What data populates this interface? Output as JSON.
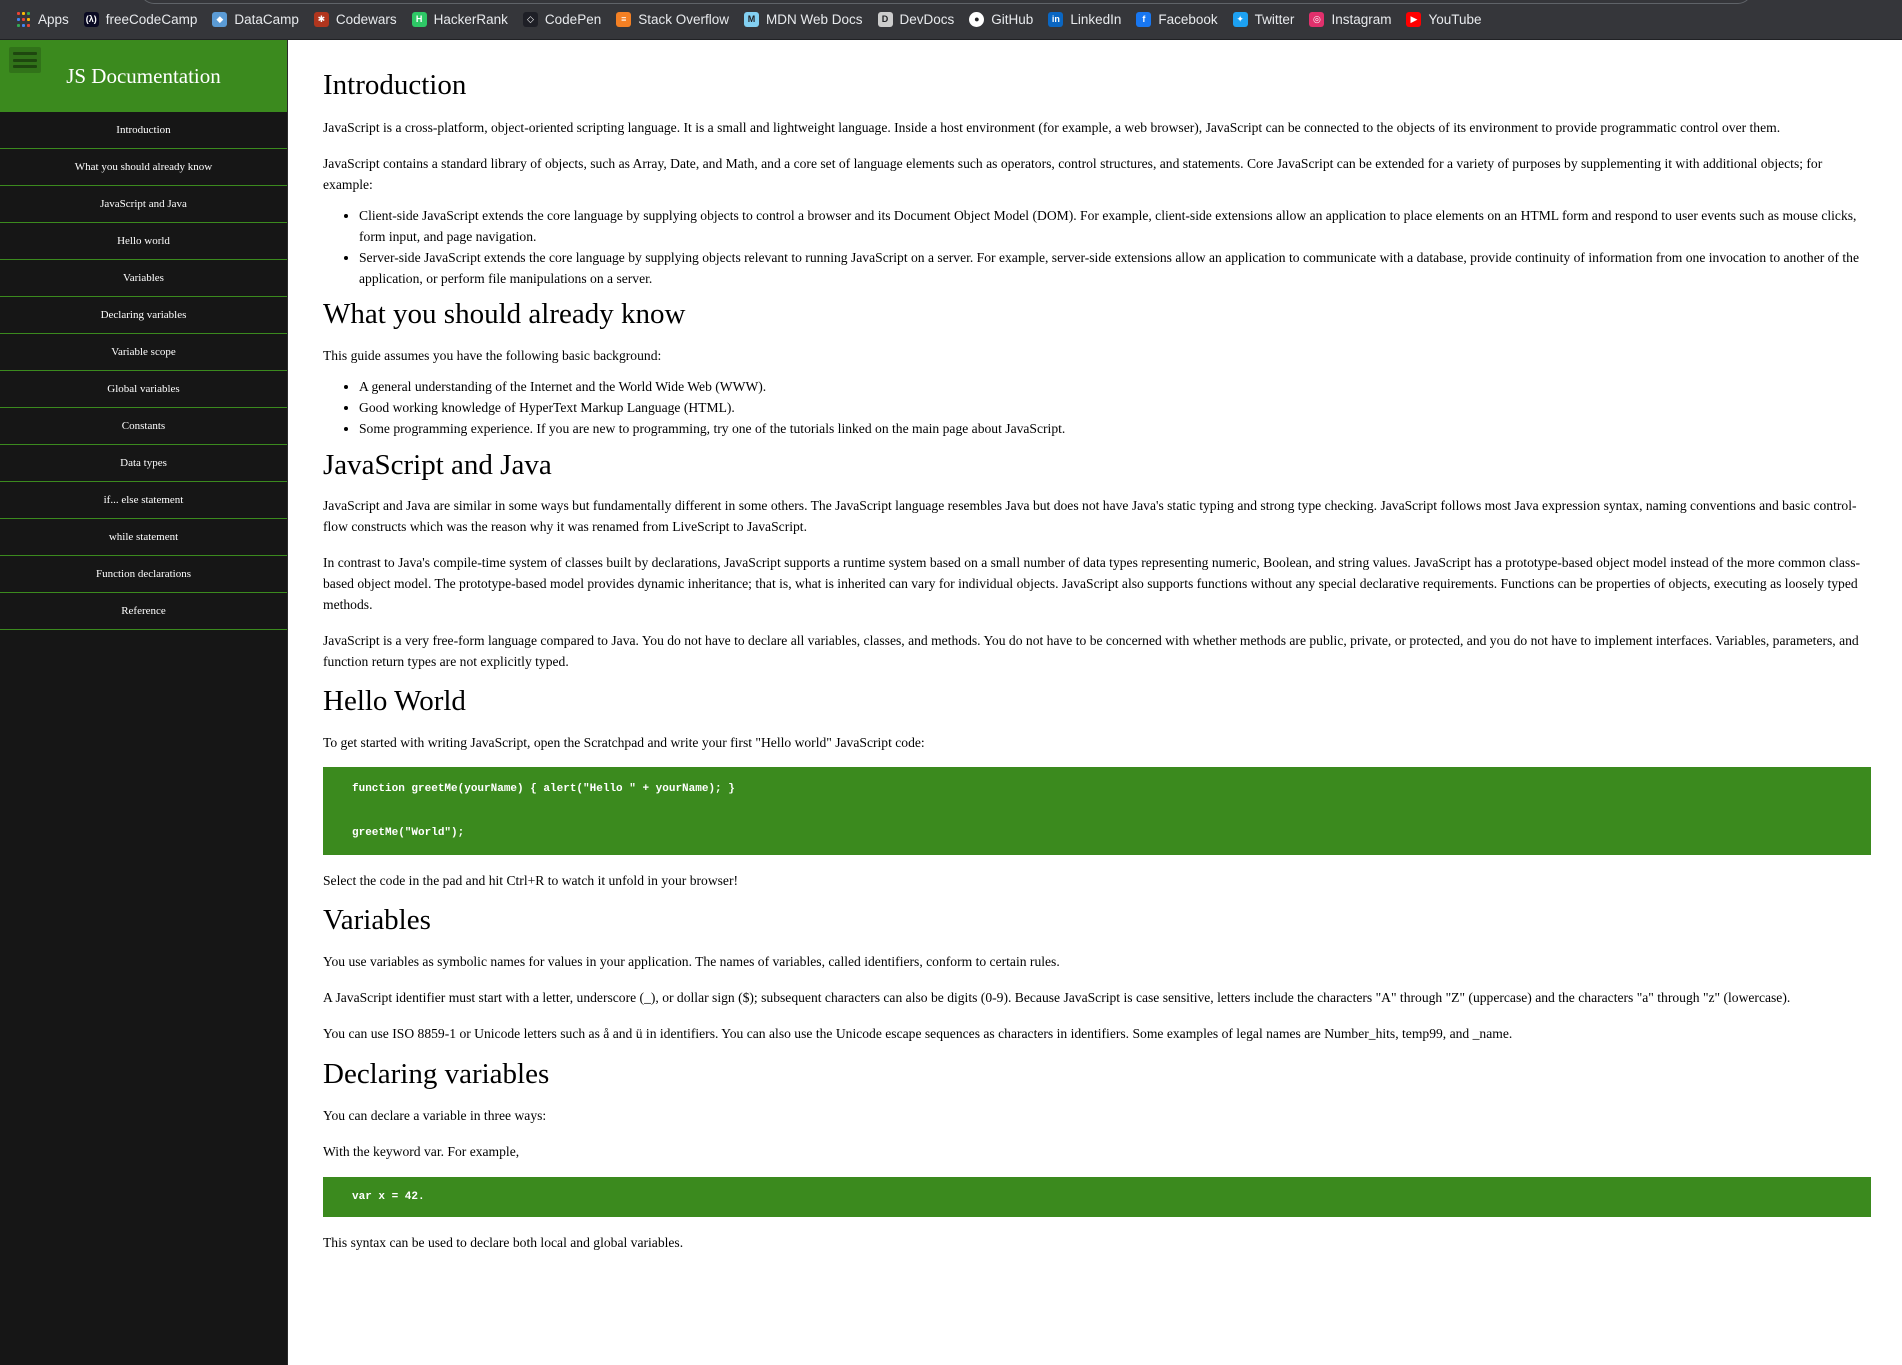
{
  "bookmarks": {
    "items": [
      {
        "label": "Apps",
        "icon": "apps-grid-icon"
      },
      {
        "label": "freeCodeCamp",
        "icon": "freecodecamp-icon",
        "color": "#0a0a23"
      },
      {
        "label": "DataCamp",
        "icon": "datacamp-icon",
        "color": "#5b9bd5"
      },
      {
        "label": "Codewars",
        "icon": "codewars-icon",
        "color": "#b1361e"
      },
      {
        "label": "HackerRank",
        "icon": "hackerrank-icon",
        "color": "#2ec866"
      },
      {
        "label": "CodePen",
        "icon": "codepen-icon",
        "color": "#1e1f26"
      },
      {
        "label": "Stack Overflow",
        "icon": "stackoverflow-icon",
        "color": "#f48024"
      },
      {
        "label": "MDN Web Docs",
        "icon": "mdn-icon",
        "color": "#83d0f2"
      },
      {
        "label": "DevDocs",
        "icon": "devdocs-icon",
        "color": "#cccccc"
      },
      {
        "label": "GitHub",
        "icon": "github-icon",
        "color": "#ffffff"
      },
      {
        "label": "LinkedIn",
        "icon": "linkedin-icon",
        "color": "#0a66c2"
      },
      {
        "label": "Facebook",
        "icon": "facebook-icon",
        "color": "#1877f2"
      },
      {
        "label": "Twitter",
        "icon": "twitter-icon",
        "color": "#1da1f2"
      },
      {
        "label": "Instagram",
        "icon": "instagram-icon",
        "color": "#e1306c"
      },
      {
        "label": "YouTube",
        "icon": "youtube-icon",
        "color": "#ff0000"
      }
    ]
  },
  "sidebar": {
    "title": "JS Documentation",
    "accent": "#3b8a1e",
    "background": "#161616",
    "items": [
      {
        "label": "Introduction"
      },
      {
        "label": "What you should already know"
      },
      {
        "label": "JavaScript and Java"
      },
      {
        "label": "Hello world"
      },
      {
        "label": "Variables"
      },
      {
        "label": "Declaring variables"
      },
      {
        "label": "Variable scope"
      },
      {
        "label": "Global variables"
      },
      {
        "label": "Constants"
      },
      {
        "label": "Data types"
      },
      {
        "label": "if... else statement"
      },
      {
        "label": "while statement"
      },
      {
        "label": "Function declarations"
      },
      {
        "label": "Reference"
      }
    ]
  },
  "main": {
    "intro": {
      "heading": "Introduction",
      "p1": "JavaScript is a cross-platform, object-oriented scripting language. It is a small and lightweight language. Inside a host environment (for example, a web browser), JavaScript can be connected to the objects of its environment to provide programmatic control over them.",
      "p2": "JavaScript contains a standard library of objects, such as Array, Date, and Math, and a core set of language elements such as operators, control structures, and statements. Core JavaScript can be extended for a variety of purposes by supplementing it with additional objects; for example:",
      "li1": "Client-side JavaScript extends the core language by supplying objects to control a browser and its Document Object Model (DOM). For example, client-side extensions allow an application to place elements on an HTML form and respond to user events such as mouse clicks, form input, and page navigation.",
      "li2": "Server-side JavaScript extends the core language by supplying objects relevant to running JavaScript on a server. For example, server-side extensions allow an application to communicate with a database, provide continuity of information from one invocation to another of the application, or perform file manipulations on a server."
    },
    "know": {
      "heading": "What you should already know",
      "p1": "This guide assumes you have the following basic background:",
      "li1": "A general understanding of the Internet and the World Wide Web (WWW).",
      "li2": "Good working knowledge of HyperText Markup Language (HTML).",
      "li3": "Some programming experience. If you are new to programming, try one of the tutorials linked on the main page about JavaScript."
    },
    "java": {
      "heading": "JavaScript and Java",
      "p1": "JavaScript and Java are similar in some ways but fundamentally different in some others. The JavaScript language resembles Java but does not have Java's static typing and strong type checking. JavaScript follows most Java expression syntax, naming conventions and basic control-flow constructs which was the reason why it was renamed from LiveScript to JavaScript.",
      "p2": "In contrast to Java's compile-time system of classes built by declarations, JavaScript supports a runtime system based on a small number of data types representing numeric, Boolean, and string values. JavaScript has a prototype-based object model instead of the more common class-based object model. The prototype-based model provides dynamic inheritance; that is, what is inherited can vary for individual objects. JavaScript also supports functions without any special declarative requirements. Functions can be properties of objects, executing as loosely typed methods.",
      "p3": "JavaScript is a very free-form language compared to Java. You do not have to declare all variables, classes, and methods. You do not have to be concerned with whether methods are public, private, or protected, and you do not have to implement interfaces. Variables, parameters, and function return types are not explicitly typed."
    },
    "hello": {
      "heading": "Hello World",
      "p1": "To get started with writing JavaScript, open the Scratchpad and write your first \"Hello world\" JavaScript code:",
      "code1": "function greetMe(yourName) { alert(\"Hello \" + yourName); }",
      "code2": "greetMe(\"World\");",
      "p2": "Select the code in the pad and hit Ctrl+R to watch it unfold in your browser!"
    },
    "variables": {
      "heading": "Variables",
      "p1": "You use variables as symbolic names for values in your application. The names of variables, called identifiers, conform to certain rules.",
      "p2": "A JavaScript identifier must start with a letter, underscore (_), or dollar sign ($); subsequent characters can also be digits (0-9). Because JavaScript is case sensitive, letters include the characters \"A\" through \"Z\" (uppercase) and the characters \"a\" through \"z\" (lowercase).",
      "p3": "You can use ISO 8859-1 or Unicode letters such as å and ü in identifiers. You can also use the Unicode escape sequences as characters in identifiers. Some examples of legal names are Number_hits, temp99, and _name."
    },
    "declaring": {
      "heading": "Declaring variables",
      "p1": "You can declare a variable in three ways:",
      "p2": "With the keyword var. For example,",
      "code1": "var x = 42.",
      "p3": "This syntax can be used to declare both local and global variables."
    }
  }
}
